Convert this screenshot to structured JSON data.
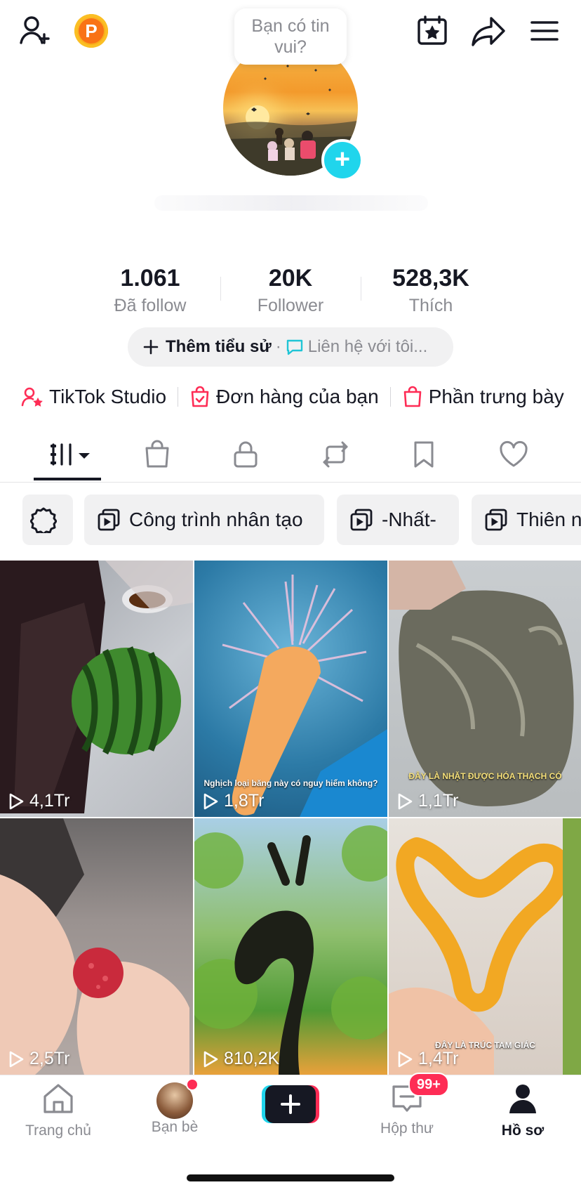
{
  "bubble_text": "Bạn có tin vui?",
  "stats": [
    {
      "value": "1.061",
      "label": "Đã follow"
    },
    {
      "value": "20K",
      "label": "Follower"
    },
    {
      "value": "528,3K",
      "label": "Thích"
    }
  ],
  "bio": {
    "add_bio": "Thêm tiểu sử",
    "separator": "·",
    "contact": "Liên hệ với tôi..."
  },
  "links": [
    {
      "label": "TikTok Studio",
      "icon": "person-star-icon"
    },
    {
      "label": "Đơn hàng của bạn",
      "icon": "shopping-bag-check-icon"
    },
    {
      "label": "Phần trưng bày",
      "icon": "shopping-bag-icon"
    }
  ],
  "tabs": [
    {
      "icon": "videos-grid-icon",
      "active": true
    },
    {
      "icon": "shop-bag-icon"
    },
    {
      "icon": "lock-icon"
    },
    {
      "icon": "repost-icon"
    },
    {
      "icon": "bookmark-icon"
    },
    {
      "icon": "heart-icon"
    }
  ],
  "collections": [
    {
      "label": "Công trình nhân tạo"
    },
    {
      "label": "-Nhất-"
    },
    {
      "label": "Thiên nhiên"
    }
  ],
  "videos": [
    {
      "views": "4,1Tr",
      "caption": ""
    },
    {
      "views": "1,8Tr",
      "caption": "Nghịch loại băng này có nguy hiểm không?"
    },
    {
      "views": "1,1Tr",
      "caption": "ĐÂY LÀ NHẶT ĐƯỢC HÓA THẠCH CÓ"
    },
    {
      "views": "2,5Tr",
      "caption": ""
    },
    {
      "views": "810,2K",
      "caption": ""
    },
    {
      "views": "1,4Tr",
      "caption": "ĐÂY LÀ TRÚC TAM GIÁC"
    }
  ],
  "bottom_nav": {
    "home": "Trang chủ",
    "friends": "Bạn bè",
    "inbox": "Hộp thư",
    "inbox_badge": "99+",
    "profile": "Hồ sơ"
  },
  "colors": {
    "accent_cyan": "#20d5ec",
    "accent_pink": "#fe2c55",
    "text_secondary": "#8a8b91"
  }
}
